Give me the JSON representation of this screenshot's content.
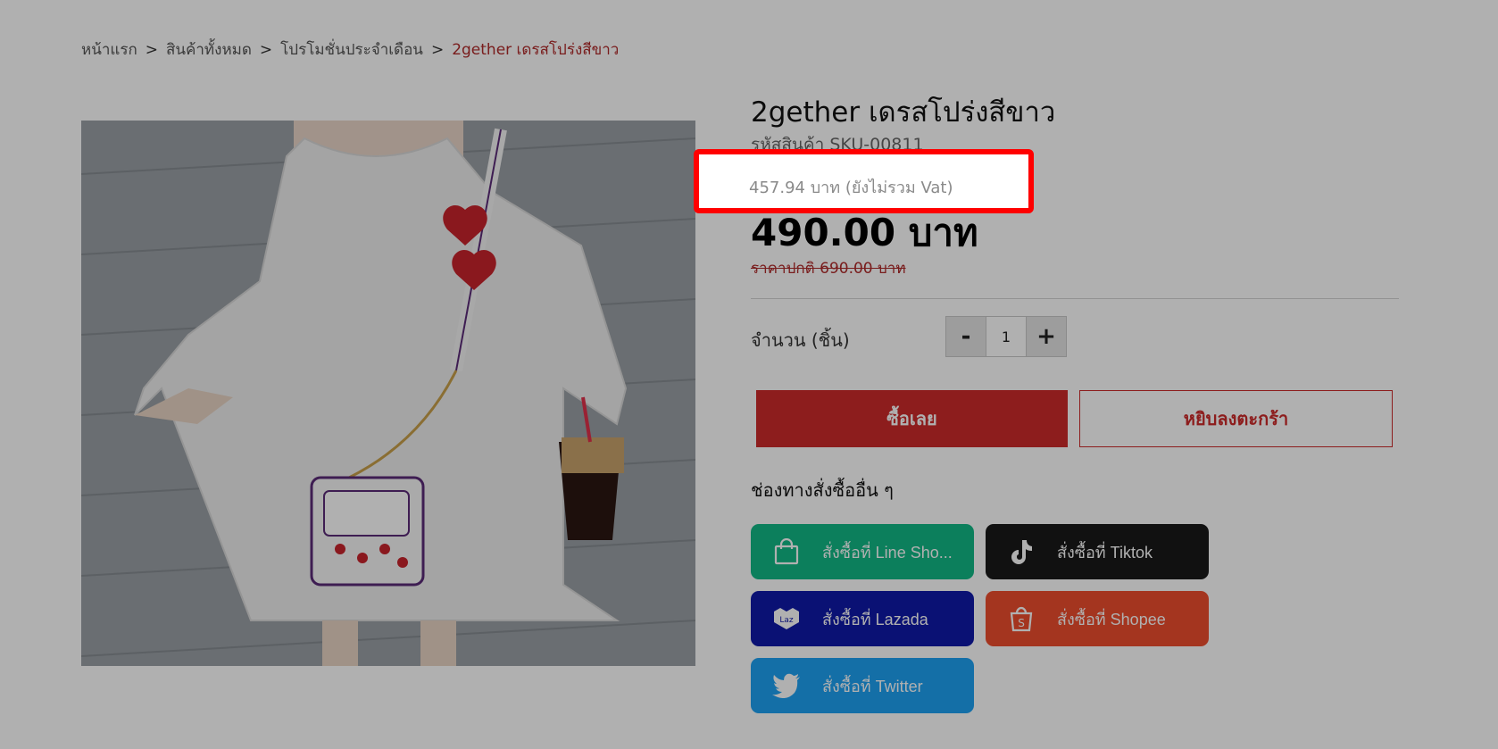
{
  "breadcrumb": {
    "items": [
      "หน้าแรก",
      "สินค้าทั้งหมด",
      "โปรโมชั่นประจำเดือน"
    ],
    "current": "2gether เดรสโปร่งสีขาว",
    "separator": ">"
  },
  "product": {
    "title": "2gether เดรสโปร่งสีขาว",
    "sku": "รหัสสินค้า SKU-00811",
    "price_novat": "457.94 บาท (ยังไม่รวม Vat)",
    "price": "490.00 บาท",
    "regular_price": "ราคาปกติ 690.00 บาท"
  },
  "quantity": {
    "label": "จำนวน (ชิ้น)",
    "value": "1",
    "minus": "-",
    "plus": "+"
  },
  "actions": {
    "buy_now": "ซื้อเลย",
    "add_to_cart": "หยิบลงตะกร้า"
  },
  "channels": {
    "title": "ช่องทางสั่งซื้ออื่น ๆ",
    "line": "สั่งซื้อที่ Line Sho...",
    "tiktok": "สั่งซื้อที่ Tiktok",
    "lazada": "สั่งซื้อที่ Lazada",
    "shopee": "สั่งซื้อที่ Shopee",
    "twitter": "สั่งซื้อที่ Twitter"
  },
  "icons": {
    "line": "shopping-bag-icon",
    "tiktok": "tiktok-icon",
    "lazada": "lazada-icon",
    "shopee": "shopee-bag-icon",
    "twitter": "twitter-bird-icon"
  },
  "colors": {
    "accent": "#cc2b2b",
    "line": "#12b886",
    "tiktok": "#1a1a1a",
    "lazada": "#0f1aa8",
    "shopee": "#ee4d2d",
    "twitter": "#1da1f2",
    "highlight_border": "#ff0000"
  }
}
